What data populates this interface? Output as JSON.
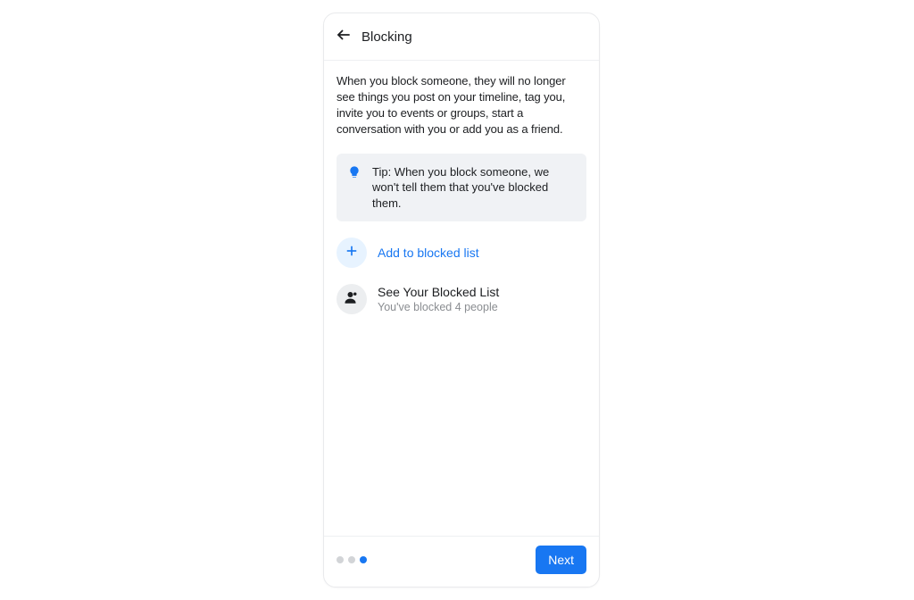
{
  "header": {
    "title": "Blocking"
  },
  "description": "When you block someone, they will no longer see things you post on your timeline, tag you, invite you to events or groups, start a conversation with you or add you as a friend.",
  "tip": {
    "text": "Tip: When you block someone, we won't tell them that you've blocked them."
  },
  "add_action": {
    "label": "Add to blocked list"
  },
  "see_blocked": {
    "title": "See Your Blocked List",
    "subtitle": "You've blocked 4 people"
  },
  "footer": {
    "next_label": "Next",
    "page_count": 3,
    "active_page_index": 2
  }
}
